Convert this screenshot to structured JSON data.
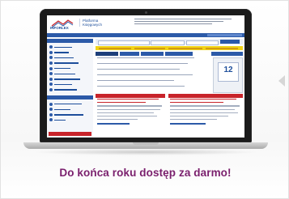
{
  "slogan": "Do końca roku dostęp za darmo!",
  "site": {
    "logo_text": "INFORLEX",
    "platform_line1": "Platforma",
    "platform_line2": "Księgowych"
  },
  "colors": {
    "brand_blue": "#2c5aa8",
    "slogan_purple": "#7a1f6d",
    "accent_red": "#c8232a",
    "accent_yellow": "#f1d316"
  },
  "calendar": {
    "day": "12"
  },
  "icons": {
    "next": "chevron-right-icon"
  }
}
